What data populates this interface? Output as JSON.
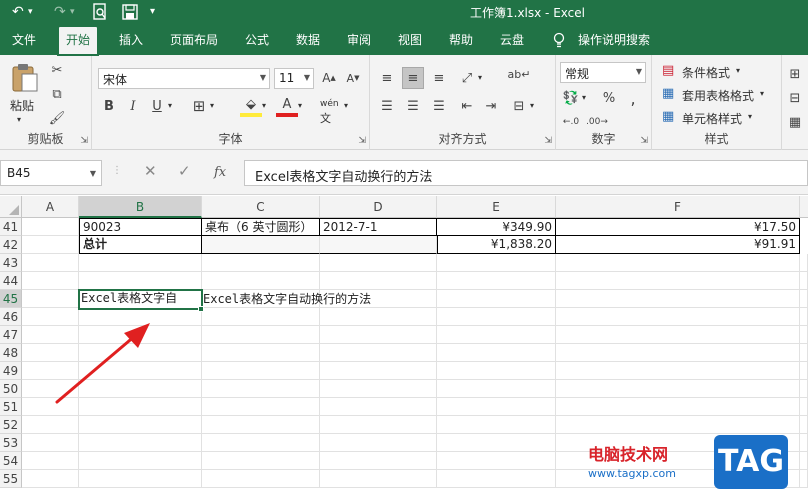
{
  "titlebar": {
    "title": "工作簿1.xlsx  -  Excel"
  },
  "tabs": [
    {
      "label": "文件"
    },
    {
      "label": "开始"
    },
    {
      "label": "插入"
    },
    {
      "label": "页面布局"
    },
    {
      "label": "公式"
    },
    {
      "label": "数据"
    },
    {
      "label": "审阅"
    },
    {
      "label": "视图"
    },
    {
      "label": "帮助"
    },
    {
      "label": "云盘"
    },
    {
      "label": "操作说明搜索"
    }
  ],
  "ribbon": {
    "clipboard": {
      "paste_label": "粘贴",
      "group_label": "剪贴板"
    },
    "font": {
      "font_name": "宋体",
      "font_size": "11",
      "group_label": "字体",
      "phonetic_label": "wén"
    },
    "alignment": {
      "group_label": "对齐方式"
    },
    "number": {
      "format": "常规",
      "group_label": "数字"
    },
    "styles": {
      "conditional": "条件格式",
      "table_format": "套用表格格式",
      "cell_styles": "单元格样式",
      "group_label": "样式"
    }
  },
  "formula_bar": {
    "name_box": "B45",
    "fx_label": "fx",
    "content": "Excel表格文字自动换行的方法"
  },
  "grid": {
    "columns": [
      "A",
      "B",
      "C",
      "D",
      "E",
      "F"
    ],
    "rows": [
      "41",
      "42",
      "43",
      "44",
      "45",
      "46",
      "47",
      "48",
      "49",
      "50",
      "51",
      "52",
      "53",
      "54",
      "55"
    ],
    "cells": {
      "b41": "90023",
      "c41": "桌布（6 英寸圆形）",
      "d41": "2012-7-1",
      "e41": "¥349.90",
      "f41": "¥17.50",
      "b42": "总计",
      "e42": "¥1,838.20",
      "f42": "¥91.91",
      "b45_visible": "Excel表格文字自",
      "c45_overflow": "Excel表格文字自动换行的方法"
    }
  },
  "watermark": {
    "site_name": "电脑技术网",
    "tag": "TAG",
    "url": "www.tagxp.com"
  },
  "colors": {
    "accent": "#217346",
    "arrow": "#e02020"
  }
}
